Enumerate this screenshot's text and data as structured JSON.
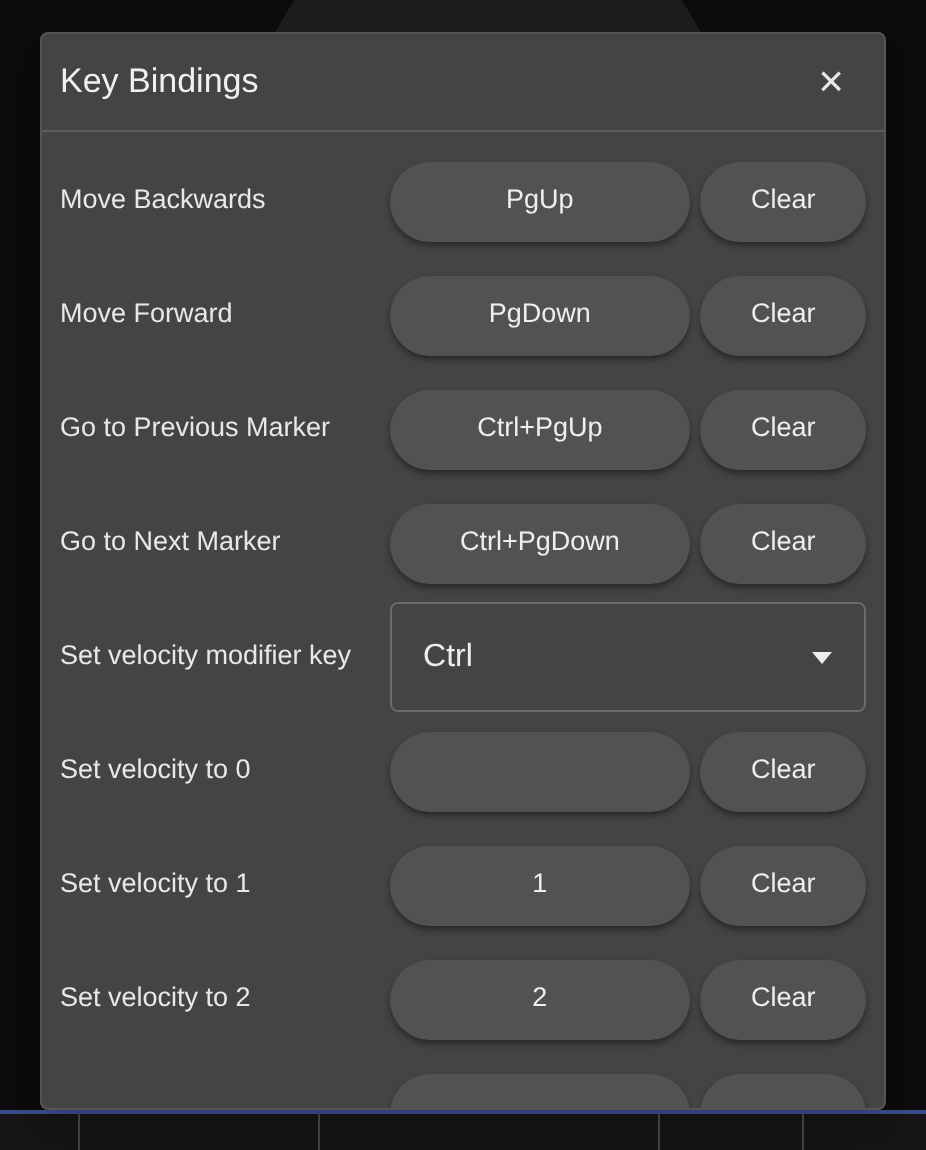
{
  "dialog": {
    "title": "Key Bindings",
    "close": "×",
    "rows": [
      {
        "kind": "key",
        "label": "Move Backwards",
        "value": "PgUp",
        "clear": "Clear"
      },
      {
        "kind": "key",
        "label": "Move Forward",
        "value": "PgDown",
        "clear": "Clear"
      },
      {
        "kind": "key",
        "label": "Go to Previous Marker",
        "value": "Ctrl+PgUp",
        "clear": "Clear"
      },
      {
        "kind": "key",
        "label": "Go to Next Marker",
        "value": "Ctrl+PgDown",
        "clear": "Clear"
      },
      {
        "kind": "select",
        "label": "Set velocity modifier key",
        "value": "Ctrl"
      },
      {
        "kind": "key",
        "label": "Set velocity to 0",
        "clear": "Clear"
      },
      {
        "kind": "key",
        "label": "Set velocity to 1",
        "value": "1",
        "clear": "Clear"
      },
      {
        "kind": "key",
        "label": "Set velocity to 2",
        "value": "2",
        "clear": "Clear"
      },
      {
        "kind": "key"
      }
    ]
  }
}
